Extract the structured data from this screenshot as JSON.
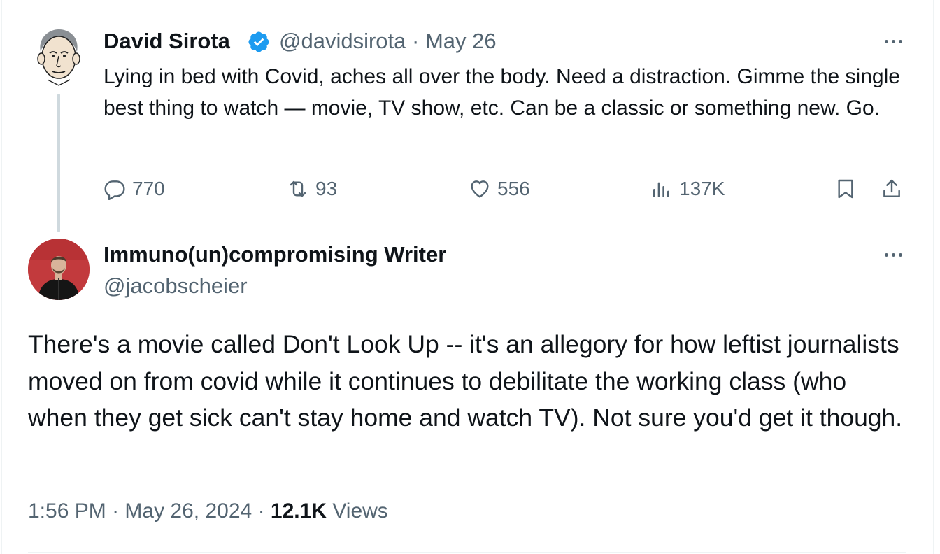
{
  "original_tweet": {
    "author_name": "David Sirota",
    "verified": true,
    "handle": "@davidsirota",
    "separator": "·",
    "date": "May 26",
    "text": "Lying in bed with Covid, aches all over the body. Need a distraction. Gimme the single best thing to watch — movie, TV show, etc. Can be a classic or something new. Go.",
    "replies": "770",
    "reposts": "93",
    "likes": "556",
    "views": "137K",
    "icons": [
      "reply-icon",
      "repost-icon",
      "like-icon",
      "views-icon",
      "bookmark-icon",
      "share-icon",
      "more-icon"
    ]
  },
  "reply_tweet": {
    "author_name": "Immuno(un)compromising Writer",
    "handle": "@jacobscheier",
    "text": "There's a movie called Don't Look Up -- it's an allegory for how leftist journalists moved on from covid while it continues to debilitate the working class (who when they get sick can't stay home and watch TV). Not sure you'd get it though.",
    "time": "1:56 PM",
    "date": "May 26, 2024",
    "separator": "·",
    "views_count": "12.1K",
    "views_label": "Views"
  },
  "colors": {
    "text_primary": "#0f1419",
    "text_secondary": "#536471",
    "verified_blue": "#1d9bf0",
    "thread_line": "#cfd9de",
    "avatar2_bg": "#c23a3d"
  }
}
